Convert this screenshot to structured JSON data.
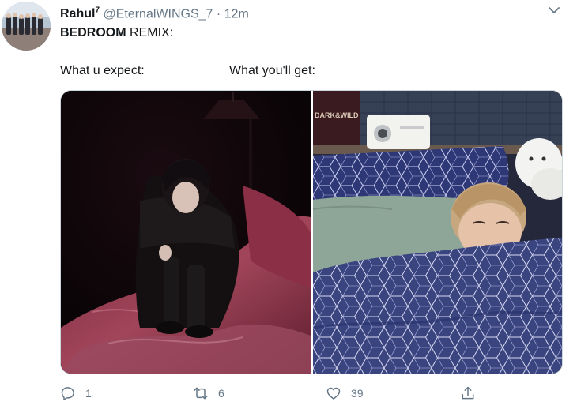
{
  "tweet": {
    "display_name": "Rahul",
    "name_superscript": "7",
    "handle": "@EternalWINGS_7",
    "separator": "·",
    "time": "12m",
    "text_bold": "BEDROOM",
    "text_rest": " REMIX:",
    "label_left": "What u expect:",
    "label_right": "What you'll get:",
    "photo_right_caption": "DARK&WILD"
  },
  "actions": {
    "reply_count": "1",
    "retweet_count": "6",
    "like_count": "39"
  },
  "icons": {
    "avatar": "avatar-icon",
    "caret": "chevron-down-icon",
    "reply": "reply-icon",
    "retweet": "retweet-icon",
    "like": "heart-icon",
    "share": "share-icon"
  },
  "colors": {
    "text_primary": "#14171a",
    "text_secondary": "#657786",
    "border": "#ccd6dd"
  }
}
